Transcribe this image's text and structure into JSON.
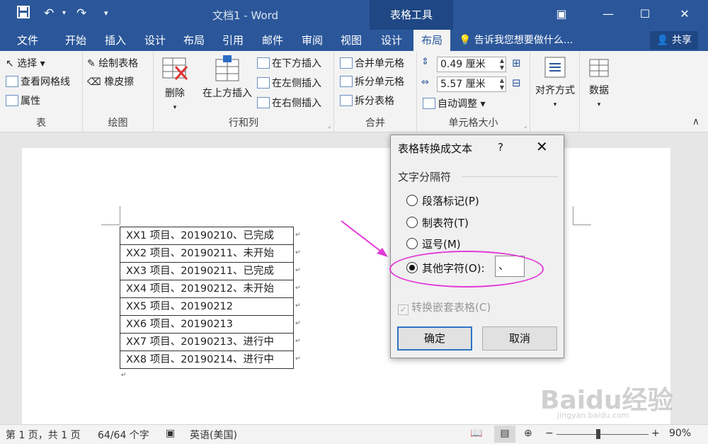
{
  "window": {
    "title": "文档1 - Word",
    "context_title": "表格工具",
    "restore_icon": "restore-window-icon",
    "minimize_icon": "minimize-icon",
    "maximize_icon": "maximize-icon",
    "close_icon": "close-icon"
  },
  "quick_access": {
    "save": "save-icon",
    "undo": "undo-icon",
    "redo": "redo-icon",
    "customize": "customize-qat-icon"
  },
  "tabs": [
    "文件",
    "开始",
    "插入",
    "设计",
    "布局",
    "引用",
    "邮件",
    "审阅",
    "视图",
    "设计",
    "布局"
  ],
  "active_tab_index": 10,
  "tellme": "告诉我您想要做什么...",
  "share": "共享",
  "ribbon": {
    "table": {
      "label": "表",
      "select": "选择",
      "gridlines": "查看网格线",
      "properties": "属性"
    },
    "draw": {
      "label": "绘图",
      "draw_table": "绘制表格",
      "eraser": "橡皮擦"
    },
    "rows_cols": {
      "label": "行和列",
      "delete": "删除",
      "insert_above": "在上方插入",
      "insert_below": "在下方插入",
      "insert_left": "在左侧插入",
      "insert_right": "在右侧插入"
    },
    "merge": {
      "label": "合并",
      "merge_cells": "合并单元格",
      "split_cells": "拆分单元格",
      "split_table": "拆分表格"
    },
    "cell_size": {
      "label": "单元格大小",
      "height": "0.49 厘米",
      "width": "5.57 厘米",
      "autofit": "自动调整"
    },
    "alignment": "对齐方式",
    "data": "数据"
  },
  "table_rows": [
    "XX1 项目、20190210、已完成",
    "XX2 项目、20190211、未开始",
    "XX3 项目、20190211、已完成",
    "XX4 项目、20190212、未开始",
    "XX5 项目、20190212",
    "XX6 项目、20190213",
    "XX7 项目、20190213、进行中",
    "XX8 项目、20190214、进行中"
  ],
  "dialog": {
    "title": "表格转换成文本",
    "help": "?",
    "section": "文字分隔符",
    "options": [
      "段落标记(P)",
      "制表符(T)",
      "逗号(M)",
      "其他字符(O):"
    ],
    "selected_index": 3,
    "other_value": "、",
    "nested_label": "转换嵌套表格(C)",
    "ok": "确定",
    "cancel": "取消"
  },
  "status": {
    "page": "第 1 页，共 1 页",
    "words": "64/64 个字",
    "language": "英语(美国)",
    "zoom": "90%",
    "zoom_minus": "−",
    "zoom_plus": "+"
  },
  "watermark": {
    "brand": "Baidu经验",
    "url": "jingyan.baidu.com"
  },
  "colors": {
    "accent": "#2b579a",
    "highlight": "#e33ad9"
  }
}
